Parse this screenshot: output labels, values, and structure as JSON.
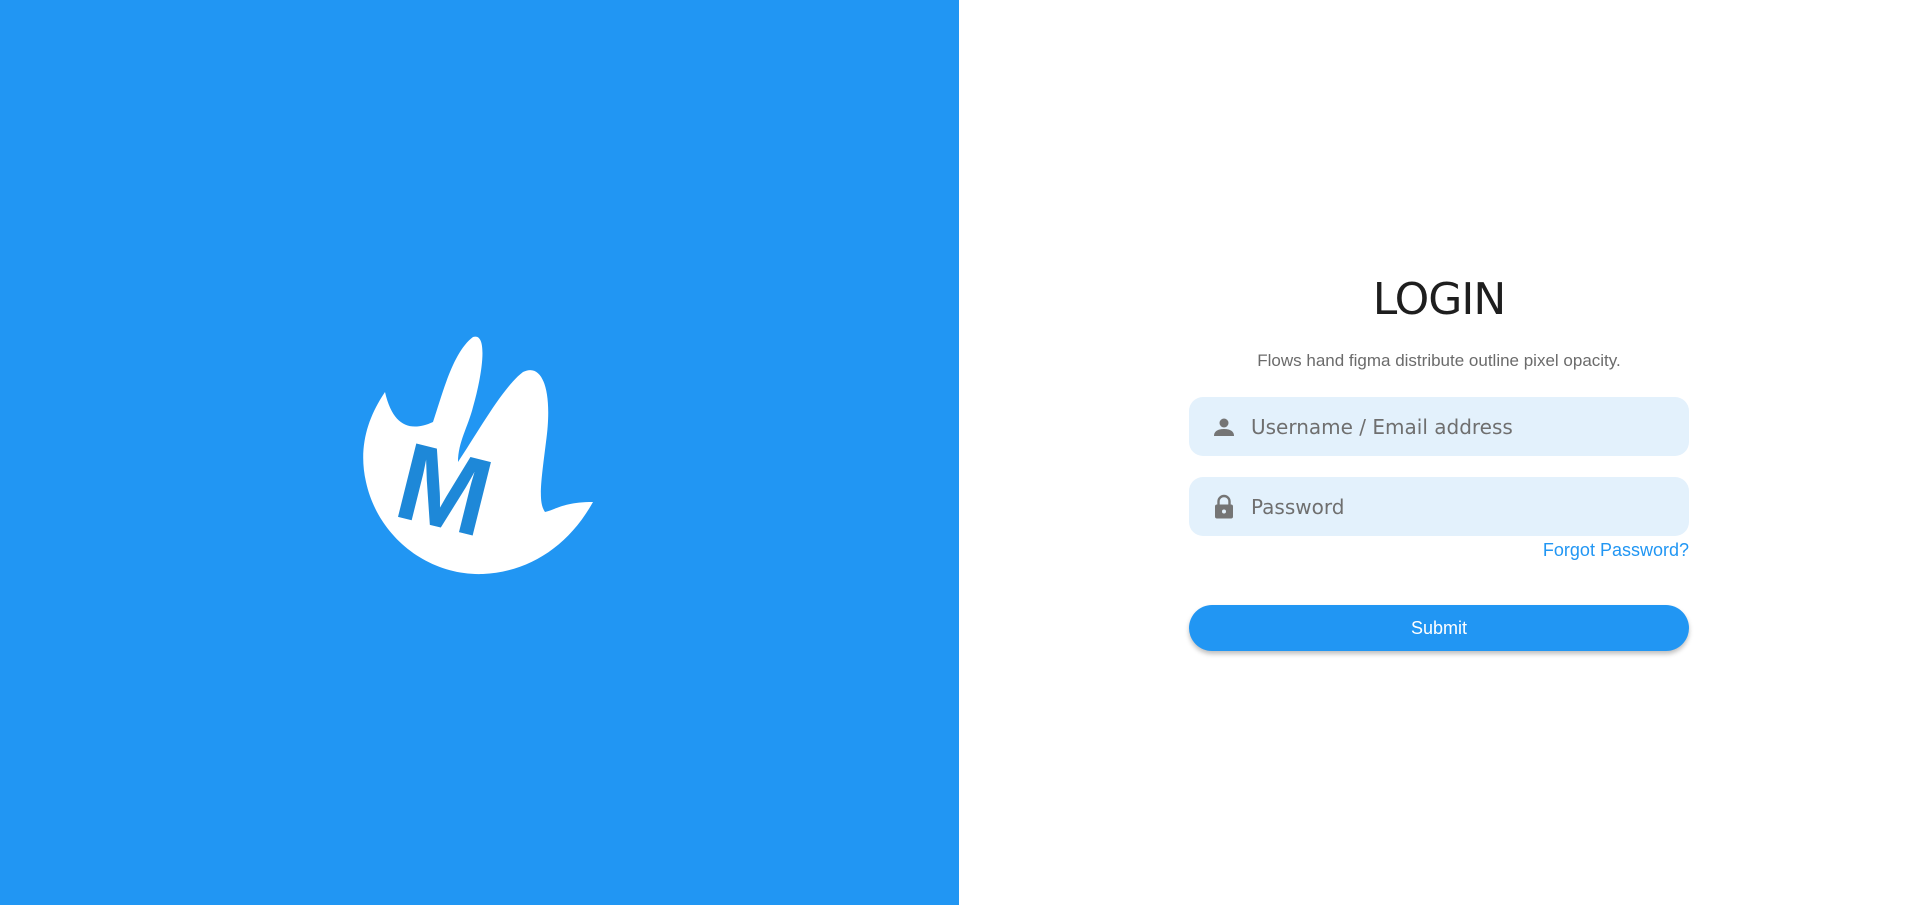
{
  "brand": {
    "logo_letter": "M",
    "panel_color": "#2196f3",
    "logo_letter_color": "#1e88d8"
  },
  "login": {
    "title": "LOGIN",
    "subtitle": "Flows hand figma distribute outline pixel opacity.",
    "username": {
      "icon": "person-icon",
      "placeholder": "Username / Email address",
      "value": ""
    },
    "password": {
      "icon": "lock-icon",
      "placeholder": "Password",
      "value": ""
    },
    "forgot_label": "Forgot Password?",
    "submit_label": "Submit",
    "accent_color": "#2196f3",
    "field_bg_color": "#e3f1fc"
  }
}
